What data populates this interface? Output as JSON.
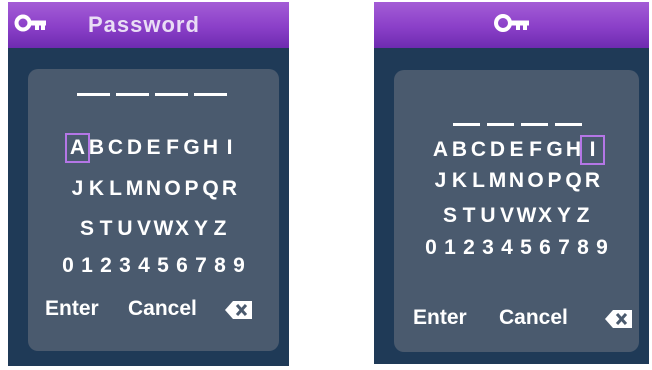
{
  "left_screen": {
    "title": "Password",
    "rows": [
      [
        "A",
        "B",
        "C",
        "D",
        "E",
        "F",
        "G",
        "H",
        "I"
      ],
      [
        "J",
        "K",
        "L",
        "M",
        "N",
        "O",
        "P",
        "Q",
        "R"
      ],
      [
        "S",
        "T",
        "U",
        "V",
        "W",
        "X",
        "Y",
        "Z"
      ],
      [
        "0",
        "1",
        "2",
        "3",
        "4",
        "5",
        "6",
        "7",
        "8",
        "9"
      ]
    ],
    "selected": "A",
    "enter_label": "Enter",
    "cancel_label": "Cancel"
  },
  "right_screen": {
    "rows": [
      [
        "A",
        "B",
        "C",
        "D",
        "E",
        "F",
        "G",
        "H",
        "I"
      ],
      [
        "J",
        "K",
        "L",
        "M",
        "N",
        "O",
        "P",
        "Q",
        "R"
      ],
      [
        "S",
        "T",
        "U",
        "V",
        "W",
        "X",
        "Y",
        "Z"
      ],
      [
        "0",
        "1",
        "2",
        "3",
        "4",
        "5",
        "6",
        "7",
        "8",
        "9"
      ]
    ],
    "selected": "I",
    "enter_label": "Enter",
    "cancel_label": "Cancel"
  },
  "colors": {
    "titlebar": "#8a3fc8",
    "background": "#1f3a57",
    "panel": "#4a5a6e",
    "selection": "#b476e6",
    "text": "#ffffff"
  },
  "icons": [
    "key-icon",
    "backspace-icon"
  ]
}
